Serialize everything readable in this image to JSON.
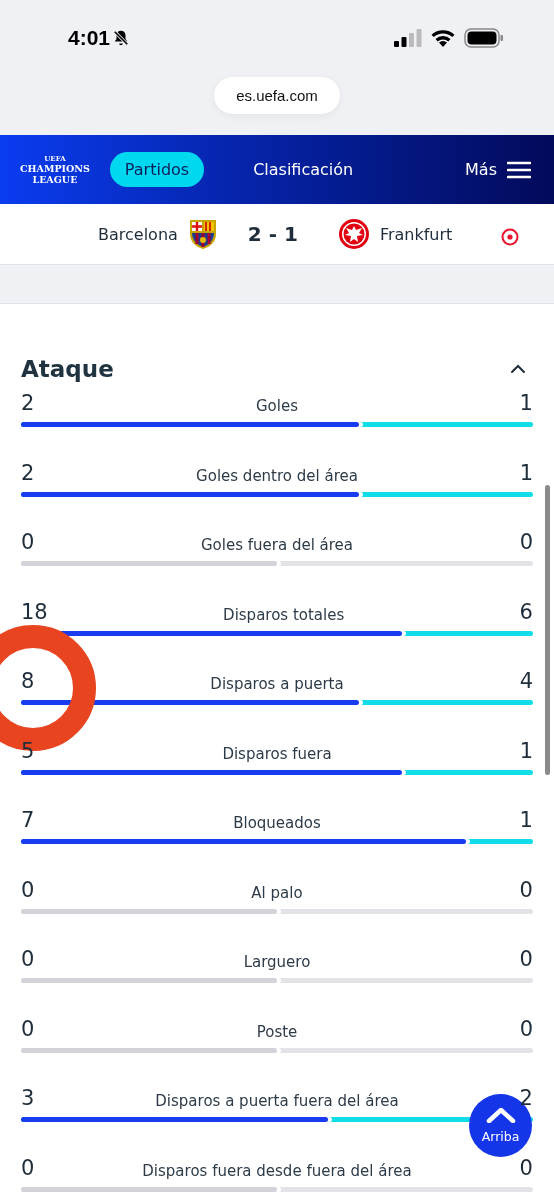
{
  "status_bar": {
    "time": "4:01"
  },
  "browser": {
    "url": "es.uefa.com"
  },
  "nav": {
    "logo": {
      "top": "UEFA",
      "line1": "CHAMPIONS",
      "line2": "LEAGUE"
    },
    "tabs": [
      {
        "label": "Partidos",
        "selected": true
      },
      {
        "label": "Clasificación",
        "selected": false
      }
    ],
    "more": "Más"
  },
  "match": {
    "home": "Barcelona",
    "score": "2 - 1",
    "away": "Frankfurt",
    "live": true
  },
  "section": {
    "title": "Ataque",
    "expanded": true
  },
  "stats": [
    {
      "home": "2",
      "label": "Goles",
      "away": "1",
      "level": 0.66,
      "active": true
    },
    {
      "home": "2",
      "label": "Goles dentro del área",
      "away": "1",
      "level": 0.66,
      "active": true
    },
    {
      "home": "0",
      "label": "Goles fuera del área",
      "away": "0",
      "level": 0.5,
      "active": false
    },
    {
      "home": "18",
      "label": "Disparos totales",
      "away": "6",
      "level": 0.745,
      "active": true
    },
    {
      "home": "8",
      "label": "Disparos a puerta",
      "away": "4",
      "level": 0.66,
      "active": true
    },
    {
      "home": "5",
      "label": "Disparos fuera",
      "away": "1",
      "level": 0.745,
      "active": true
    },
    {
      "home": "7",
      "label": "Bloqueados",
      "away": "1",
      "level": 0.87,
      "active": true
    },
    {
      "home": "0",
      "label": "Al palo",
      "away": "0",
      "level": 0.5,
      "active": false
    },
    {
      "home": "0",
      "label": "Larguero",
      "away": "0",
      "level": 0.5,
      "active": false
    },
    {
      "home": "0",
      "label": "Poste",
      "away": "0",
      "level": 0.5,
      "active": false
    },
    {
      "home": "3",
      "label": "Disparos a puerta fuera del área",
      "away": "2",
      "level": 0.6,
      "active": true
    },
    {
      "home": "0",
      "label": "Disparos fuera desde fuera del área",
      "away": "0",
      "level": 0.5,
      "active": false
    }
  ],
  "back_to_top": "Arriba"
}
